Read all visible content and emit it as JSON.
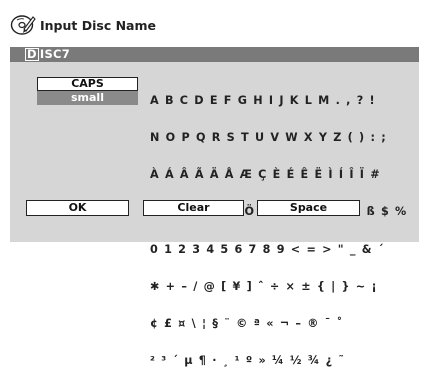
{
  "header": {
    "title": "Input Disc Name"
  },
  "name_bar": {
    "value": "DISC7"
  },
  "mode_buttons": {
    "caps": "CAPS",
    "small": "small"
  },
  "charset_rows": [
    "A B C D E F G H I J K L M . , ? !",
    "N O P Q R S T U V W X Y Z ( ) : ;",
    "À Á Â Ã Ä Å Æ Ç È É Ê Ë Ì Í Î Ï #",
    "Ð Ñ Ò Ó Ô Õ Ö Ø Ù Ú Û Ü Ý Þ ß $ %",
    "0 1 2 3 4 5 6 7 8 9 < = > \" _ & ´",
    "✱ + – / @ [ ¥ ] ˆ ÷ × ± { | } ~ ¡",
    "¢ £ ¤ \\ ¦ § ¨ © ª « ¬ – ® ¯ ˚",
    "² ³ ´ µ ¶ · ¸ ¹ º » ¼ ½ ¾ ¿ ˜"
  ],
  "bottom_buttons": {
    "ok": "OK",
    "clear": "Clear",
    "space": "Space"
  }
}
